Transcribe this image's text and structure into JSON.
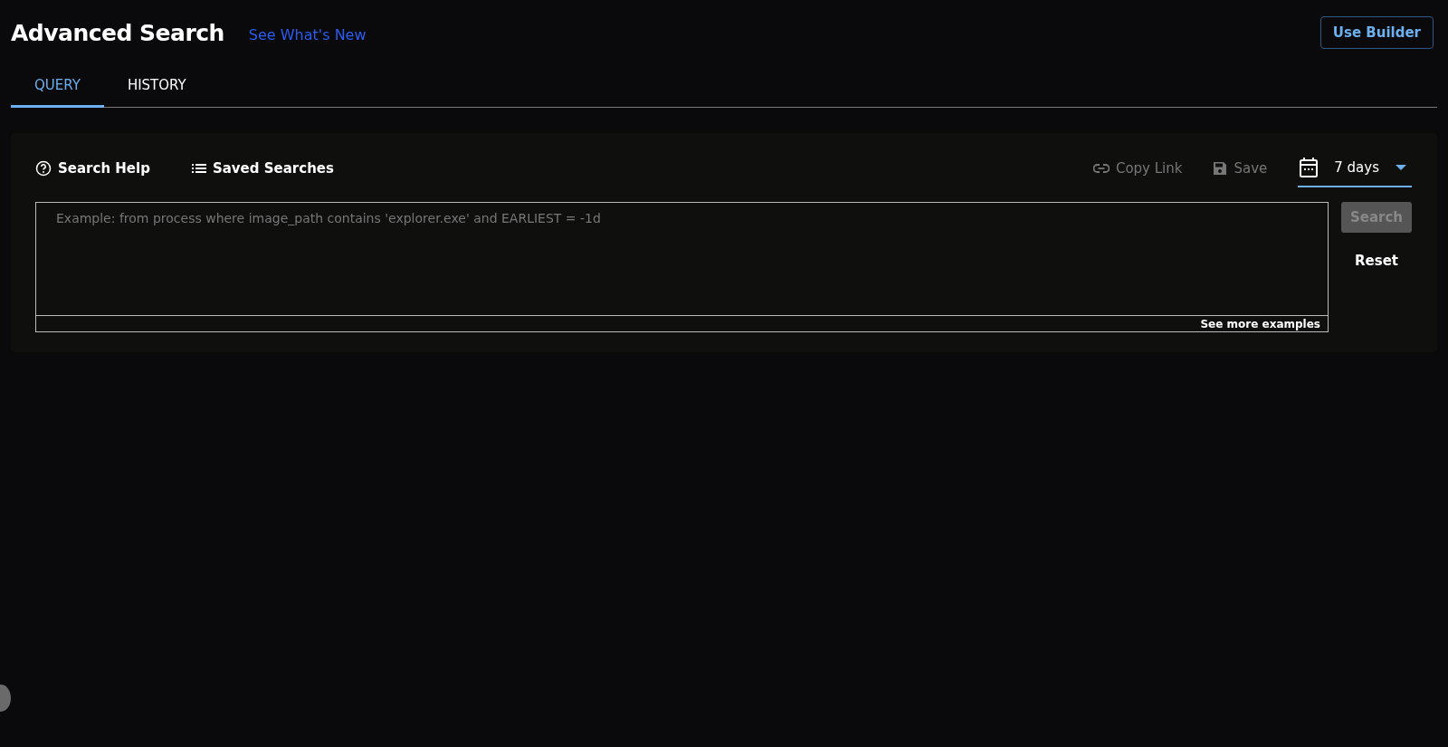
{
  "header": {
    "title": "Advanced Search",
    "link": "See What's New",
    "button": "Use Builder"
  },
  "tabs": [
    {
      "label": "QUERY",
      "selected": true
    },
    {
      "label": "HISTORY",
      "selected": false
    }
  ],
  "toolbar": {
    "left": [
      {
        "label": "Search Help",
        "kind": "help"
      },
      {
        "label": "Saved Searches",
        "kind": "list"
      }
    ],
    "right": [
      {
        "label": "Copy Link",
        "kind": "link",
        "disabled": true
      },
      {
        "label": "Save",
        "kind": "save",
        "disabled": true
      }
    ],
    "range": "7 days"
  },
  "query": {
    "placeholder": "Example: from process where image_path contains 'explorer.exe' and EARLIEST = -1d",
    "examples_link": "See more examples"
  },
  "actions": [
    {
      "label": "Search",
      "kind": "primary",
      "disabled": true
    },
    {
      "label": "Reset",
      "kind": "plain",
      "disabled": false
    }
  ]
}
